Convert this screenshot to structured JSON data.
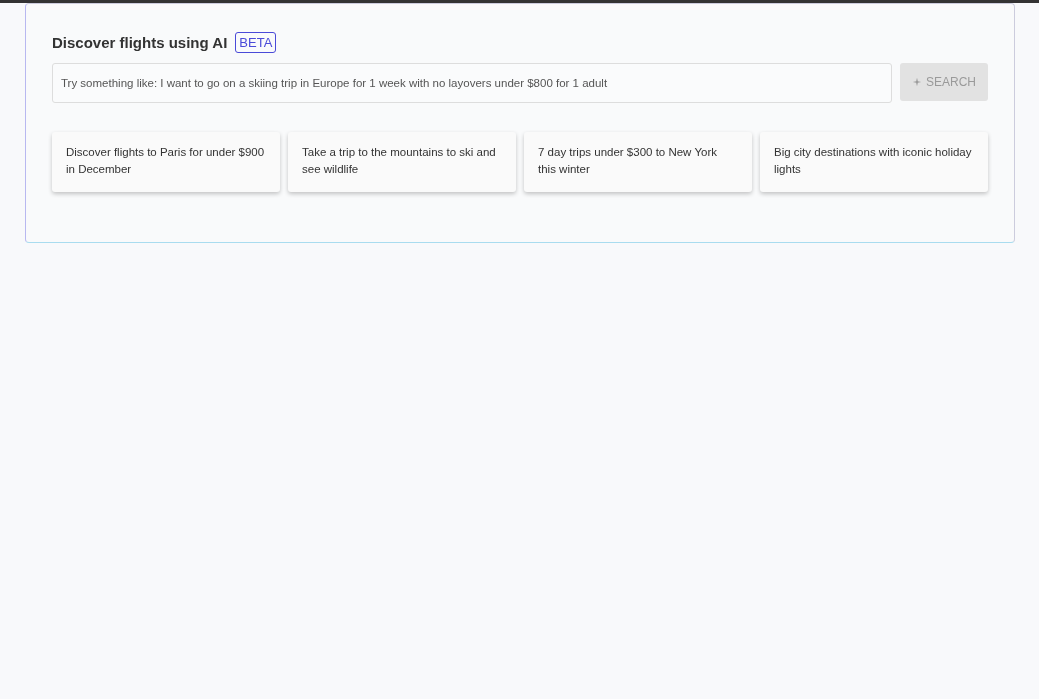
{
  "panel": {
    "title": "Discover flights using AI",
    "badge": "BETA"
  },
  "search": {
    "placeholder": "Try something like: I want to go on a skiing trip in Europe for 1 week with no layovers under $800 for 1 adult",
    "button": {
      "label": "SEARCH",
      "disabled": true
    }
  },
  "suggestions": [
    {
      "text": "Discover flights to Paris for under $900 in December"
    },
    {
      "text": "Take a trip to the mountains to ski and see wildlife"
    },
    {
      "text": "7 day trips under $300 to New York this winter"
    },
    {
      "text": "Big city destinations with iconic holiday lights"
    }
  ]
}
